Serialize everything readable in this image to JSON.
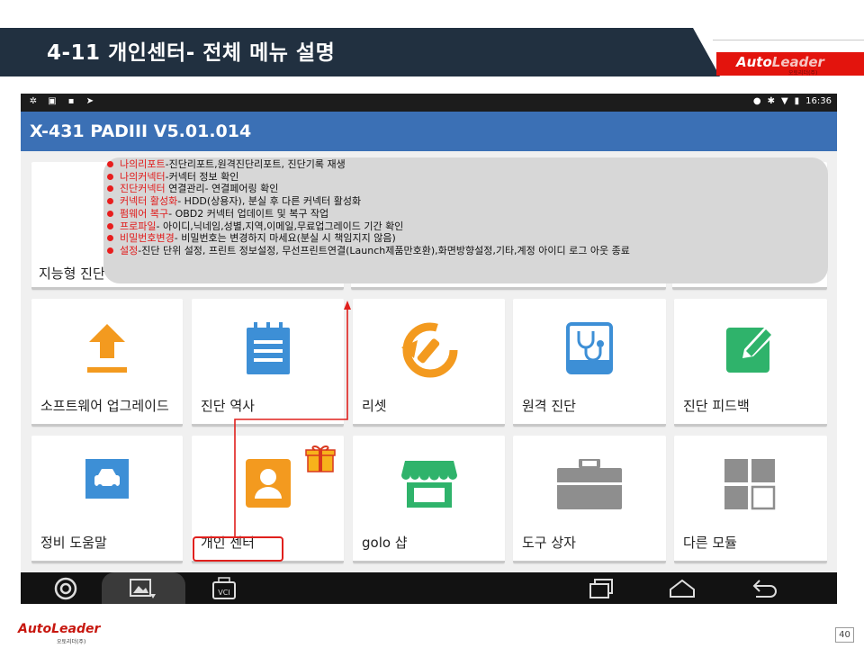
{
  "slide": {
    "title": "4-11 개인센터- 전체 메뉴 설명",
    "page_number": "40",
    "brand": {
      "auto": "Auto",
      "leader": "Leader",
      "sub": "오토리더(주)"
    },
    "colors": {
      "header_navy": "#213040",
      "brand_red": "#e3140d",
      "annotation_red": "#e0201d"
    }
  },
  "statusbar": {
    "left_icons": [
      "android-debug-icon",
      "image-icon",
      "notification-icon",
      "send-icon"
    ],
    "right_icons": [
      "location-icon",
      "bluetooth-icon",
      "wifi-icon",
      "battery-icon"
    ],
    "time": "16:36"
  },
  "app": {
    "title": "X-431 PADIII V5.01.014",
    "accent": "#3b70b5"
  },
  "row1_partial_label": "지능형 진단",
  "tiles": [
    {
      "label": "소프트웨어 업그레이드",
      "icon": "upload-arrow-icon",
      "color": "#f39a1f"
    },
    {
      "label": "진단 역사",
      "icon": "notepad-icon",
      "color": "#3d8fd6"
    },
    {
      "label": "리셋",
      "icon": "reset-wrench-icon",
      "color": "#f39a1f"
    },
    {
      "label": "원격 진단",
      "icon": "stethoscope-icon",
      "color": "#3d8fd6"
    },
    {
      "label": "진단 피드백",
      "icon": "edit-pencil-icon",
      "color": "#2fb36b"
    },
    {
      "label": "정비 도움말",
      "icon": "car-manual-icon",
      "color": "#3d8fd6"
    },
    {
      "label": "개인 센터",
      "icon": "person-icon",
      "color": "#f39a1f",
      "badge": "gift-icon"
    },
    {
      "label": "golo 샵",
      "icon": "shop-icon",
      "color": "#2fb36b"
    },
    {
      "label": "도구 상자",
      "icon": "toolbox-icon",
      "color": "#8e8e8e"
    },
    {
      "label": "다른 모듈",
      "icon": "modules-grid-icon",
      "color": "#8e8e8e"
    }
  ],
  "callout": {
    "items": [
      {
        "key": "나의리포트",
        "desc": "-진단리포트,원격진단리포트,  진단기록 재생"
      },
      {
        "key": "나의커넥터",
        "desc": "-커넥터  정보 확인"
      },
      {
        "key": "진단커넥터",
        "desc": " 연결관리-  연결페어링 확인"
      },
      {
        "key": "커넥터 활성화",
        "desc": "- HDD(상용자),  분실 후 다른 커넥터 활성화"
      },
      {
        "key": "펌웨어 복구",
        "desc": "- OBD2 커넥터 업데이트 및 복구 작업"
      },
      {
        "key": "프로파일",
        "desc": "- 아이디,닉네임,성별,지역,이메일,무료업그레이드  기간 확인"
      },
      {
        "key": "비밀번호변경",
        "desc": "-  비밀번호는 변경하지 마세요(분실 시 책임지지 않음)"
      },
      {
        "key": "설정",
        "desc": "-진단 단위 설정, 프린트 정보설정, 무선프린트연결(Launch제품만호환),화면방향설정,기타,계정  아이디 로그 아웃 종료"
      }
    ]
  },
  "navbar": {
    "buttons": [
      "browser-icon",
      "screenshot-icon",
      "vci-icon",
      "recent-apps-icon",
      "home-icon",
      "back-icon"
    ],
    "vci_label": "VCI"
  }
}
